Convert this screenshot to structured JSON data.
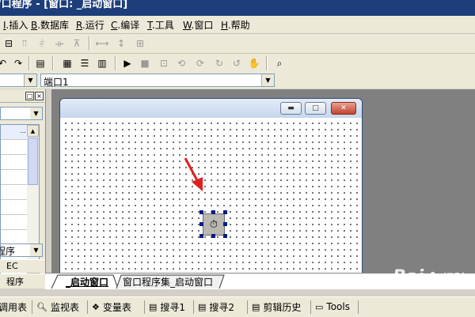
{
  "title_bar": {
    "text": "ows窗口程序 - [窗口: _启动窗口]"
  },
  "menu": [
    {
      "key": "I",
      "label": ".插入"
    },
    {
      "key": "B",
      "label": ".数据库"
    },
    {
      "key": "R",
      "label": ".运行"
    },
    {
      "key": "C",
      "label": ".编译"
    },
    {
      "key": "T",
      "label": ".工具"
    },
    {
      "key": "W",
      "label": ".窗口"
    },
    {
      "key": "H",
      "label": ".帮助"
    }
  ],
  "combo_left": {
    "value": ""
  },
  "combo_main": {
    "value": "端口1"
  },
  "left_panel": {
    "dropdown_value": "程序",
    "tab_ec": "EC",
    "tab_program": "程序"
  },
  "designer_tabs": [
    {
      "label": "_启动窗口",
      "active": true
    },
    {
      "label": "窗口程序集_启动窗口",
      "active": false
    }
  ],
  "bottom_tabs": [
    {
      "label": "调用表",
      "icon": "call-table-icon"
    },
    {
      "label": "监视表",
      "icon": "magnifier-icon"
    },
    {
      "label": "变量表",
      "icon": "variable-icon"
    },
    {
      "label": "搜寻1",
      "icon": "search-result-icon"
    },
    {
      "label": "搜寻2",
      "icon": "search-result-icon"
    },
    {
      "label": "剪辑历史",
      "icon": "clipboard-icon"
    },
    {
      "label": "Tools",
      "icon": "window-icon"
    }
  ],
  "watermark": {
    "brand": "Bai",
    "sub": "经验"
  },
  "colors": {
    "title": "#1d3e7b",
    "handle": "#0a1a8a",
    "arrow": "#e02020"
  }
}
